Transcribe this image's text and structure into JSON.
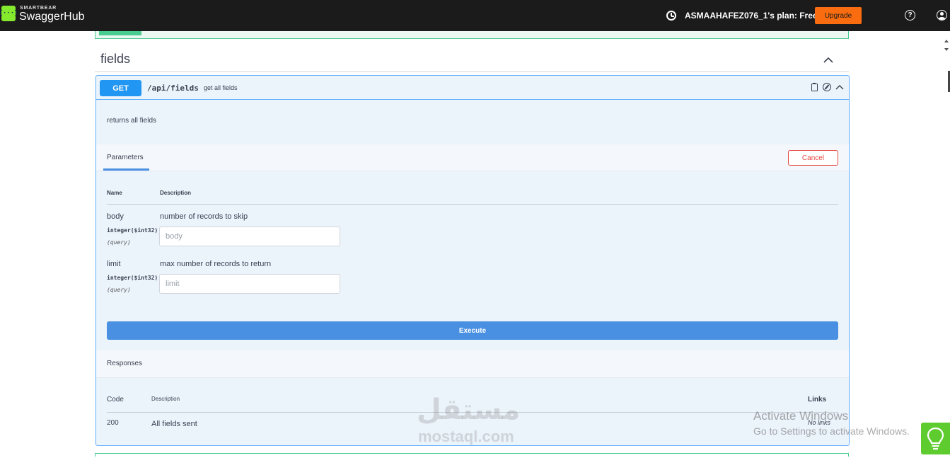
{
  "topbar": {
    "brand_small": "SMARTBEAR",
    "brand": "SwaggerHub",
    "logo_glyph": "{···}",
    "plan_text": "ASMAAHAFEZ076_1's plan: Free",
    "upgrade_label": "Upgrade",
    "help_glyph": "?"
  },
  "section": {
    "title": "fields"
  },
  "operation": {
    "method": "GET",
    "path": "/api/fields",
    "summary": "get all fields",
    "description": "returns all fields",
    "tab_parameters": "Parameters",
    "cancel_label": "Cancel",
    "col_name": "Name",
    "col_description": "Description",
    "params": [
      {
        "name": "body",
        "type": "integer($int32)",
        "in": "(query)",
        "description": "number of records to skip",
        "placeholder": "body"
      },
      {
        "name": "limit",
        "type": "integer($int32)",
        "in": "(query)",
        "description": "max number of records to return",
        "placeholder": "limit"
      }
    ],
    "execute_label": "Execute",
    "responses_title": "Responses",
    "resp_col_code": "Code",
    "resp_col_description": "Description",
    "resp_col_links": "Links",
    "responses": [
      {
        "code": "200",
        "description": "All fields sent",
        "links": "No links"
      }
    ]
  },
  "watermark": {
    "arabic": "مستقل",
    "latin": "mostaql.com"
  },
  "windows": {
    "line1": "Activate Windows",
    "line2": "Go to Settings to activate Windows."
  },
  "colors": {
    "get": "#2196f3",
    "upgrade": "#f96d10",
    "execute": "#4990e2",
    "cancel": "#e54841",
    "bulb": "#5ecb2f"
  }
}
